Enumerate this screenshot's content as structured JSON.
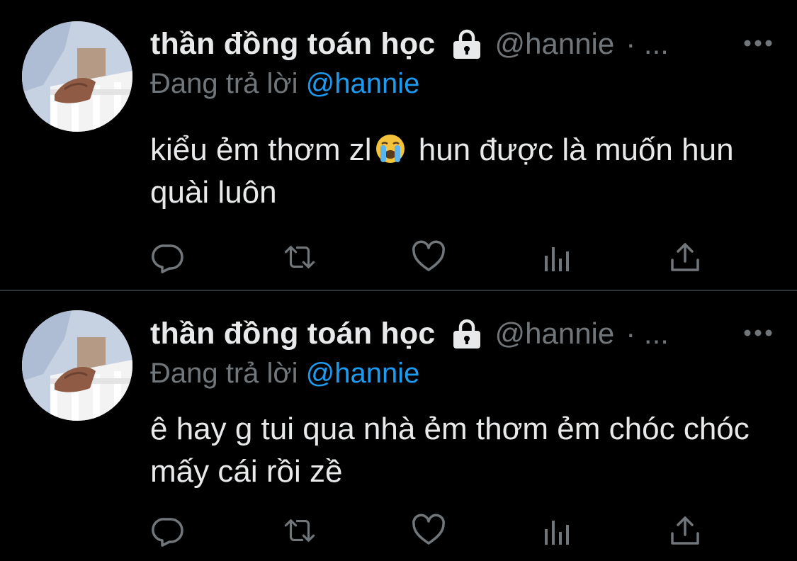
{
  "colors": {
    "background": "#000000",
    "name": "#e7e9ea",
    "secondary": "#71767b",
    "mention": "#1d9bf0",
    "divider": "#2f3336"
  },
  "tweets": [
    {
      "display_name": "thần đồng toán học",
      "handle": "@hannie",
      "meta_suffix": "· ...",
      "replying_prefix": "Đang trả lời",
      "replying_to": "@hannie",
      "text_before_emoji": "kiểu ẻm thơm zl",
      "emoji": "loudly-crying-face-icon",
      "text_after_emoji": " hun được là muốn hun quài luôn",
      "actions": [
        "reply-icon",
        "retweet-icon",
        "like-icon",
        "analytics-icon",
        "share-icon"
      ]
    },
    {
      "display_name": "thần đồng toán học",
      "handle": "@hannie",
      "meta_suffix": "· ...",
      "replying_prefix": "Đang trả lời",
      "replying_to": "@hannie",
      "text": "ê hay g tui qua nhà ẻm thơm ẻm chóc chóc mấy cái rồi zề",
      "actions": [
        "reply-icon",
        "retweet-icon",
        "like-icon",
        "analytics-icon",
        "share-icon"
      ]
    }
  ]
}
